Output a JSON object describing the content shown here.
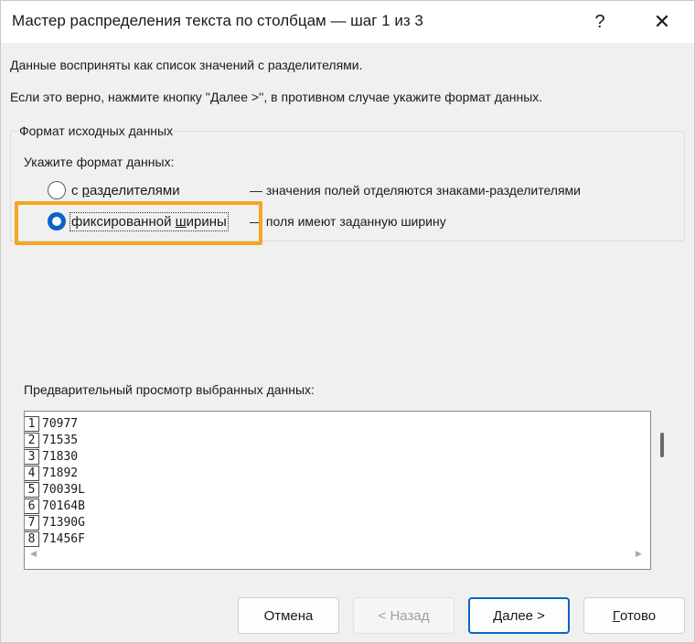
{
  "window": {
    "title": "Мастер распределения текста по столбцам — шаг 1 из 3",
    "help_glyph": "?",
    "close_glyph": "✕"
  },
  "info": {
    "line1": "Данные восприняты как список значений с разделителями.",
    "line2": "Если это верно, нажмите кнопку ''Далее >'', в противном случае укажите формат данных."
  },
  "format_group": {
    "title": "Формат исходных данных",
    "prompt": "Укажите формат данных:",
    "options": [
      {
        "label_pre": "с ",
        "label_accel": "р",
        "label_post": "азделителями",
        "description": "— значения полей отделяются знаками-разделителями",
        "checked": false
      },
      {
        "label_pre": "фиксированной ",
        "label_accel": "ш",
        "label_post": "ирины",
        "description": "— поля имеют заданную ширину",
        "checked": true
      }
    ]
  },
  "highlight_color": "#f5a623",
  "preview": {
    "label": "Предварительный просмотр выбранных данных:",
    "rows": [
      {
        "num": "1",
        "value": "70977"
      },
      {
        "num": "2",
        "value": "71535"
      },
      {
        "num": "3",
        "value": "71830"
      },
      {
        "num": "4",
        "value": "71892"
      },
      {
        "num": "5",
        "value": "70039L"
      },
      {
        "num": "6",
        "value": "70164B"
      },
      {
        "num": "7",
        "value": "71390G"
      },
      {
        "num": "8",
        "value": "71456F"
      }
    ],
    "scroll_left_glyph": "◀",
    "scroll_right_glyph": "▶"
  },
  "buttons": {
    "cancel": "Отмена",
    "back": "< Назад",
    "next": "Далее >",
    "finish_accel": "Г",
    "finish_rest": "отово"
  },
  "accent_color": "#0a64c8"
}
